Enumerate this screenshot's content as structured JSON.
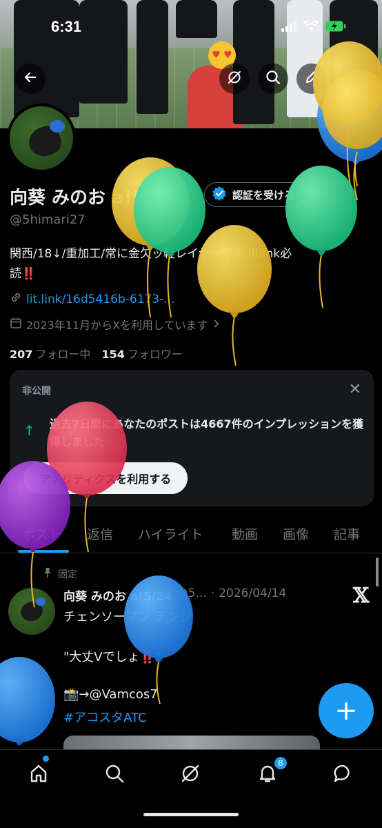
{
  "status_bar": {
    "time": "6:31"
  },
  "profile": {
    "name": "向葵 みのお",
    "name_suffix": "a!5/24",
    "verify_label": "認証を受ける",
    "handle": "@5himari27",
    "bio_line1": "関西/18↓/重加工/常に金欠ッ軽レイヤーです litlink必",
    "bio_line2": "読",
    "bio_mark": "‼️",
    "link": "lit.link/16d5416b-6173-...",
    "joined": "2023年11月からXを利用しています",
    "following_count": "207",
    "following_label": "フォロー中",
    "followers_count": "154",
    "followers_label": "フォロワー"
  },
  "analytics_card": {
    "private_label": "非公開",
    "message": "過去7日間にあなたのポストは4667件のインプレッションを獲得しました",
    "button_label": "アナリティクスを利用する"
  },
  "tabs": [
    "ポスト",
    "返信",
    "ハイライト",
    "動画",
    "画像",
    "記事"
  ],
  "pinned_tweet": {
    "pinned_label": "固定",
    "author": "向葵 みのお",
    "author_suffix": "a!5/24",
    "handle_trunc": "@5...",
    "date": "2026/04/14",
    "line1": "チェンソーマン デンジ",
    "line2": "\"大丈Vでしょ",
    "line2_mark": "‼️",
    "line2_end": "\"",
    "line3": "📸→@Vamcos7",
    "hashtag": "#アコスタATC"
  },
  "bottom_nav": {
    "notifications_badge": "8"
  },
  "colors": {
    "accent": "#1d9bf0",
    "background": "#000000",
    "card": "#16181c",
    "muted": "#71767b"
  },
  "icons": [
    "back-arrow-icon",
    "grok-icon",
    "search-icon",
    "edit-icon",
    "verified-icon",
    "link-icon",
    "calendar-icon",
    "close-icon",
    "arrow-up-icon",
    "pin-icon",
    "x-logo-icon",
    "compose-icon",
    "home-icon",
    "explore-icon",
    "notifications-icon",
    "messages-icon"
  ]
}
